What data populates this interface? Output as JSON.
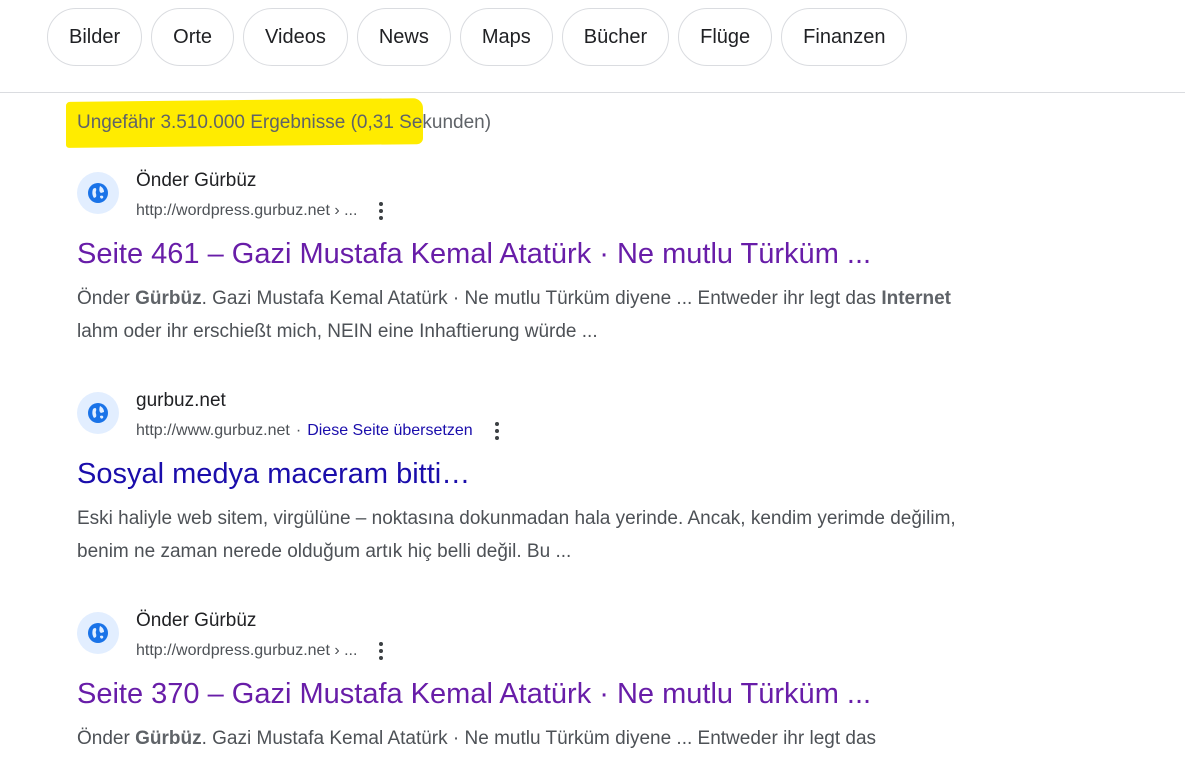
{
  "tabs": [
    {
      "label": "Bilder"
    },
    {
      "label": "Orte"
    },
    {
      "label": "Videos"
    },
    {
      "label": "News"
    },
    {
      "label": "Maps"
    },
    {
      "label": "Bücher"
    },
    {
      "label": "Flüge"
    },
    {
      "label": "Finanzen"
    }
  ],
  "stats": {
    "text": "Ungefähr 3.510.000 Ergebnisse (0,31 Sekunden)"
  },
  "results": [
    {
      "site_name": "Önder Gürbüz",
      "url": "http://wordpress.gurbuz.net › ...",
      "title": "Seite 461 – Gazi Mustafa Kemal Atatürk · Ne mutlu Türküm ...",
      "snippet_parts": [
        {
          "t": "Önder ",
          "b": false
        },
        {
          "t": "Gürbüz",
          "b": true
        },
        {
          "t": ". Gazi Mustafa Kemal Atatürk · Ne mutlu Türküm diyene ... Entweder ihr legt das ",
          "b": false
        },
        {
          "t": "Internet",
          "b": true
        },
        {
          "t": " lahm oder ihr erschießt mich, NEIN eine Inhaftierung würde ...",
          "b": false
        }
      ]
    },
    {
      "site_name": "gurbuz.net",
      "url": "http://www.gurbuz.net",
      "separator": "·",
      "translate_label": "Diese Seite übersetzen",
      "title": "Sosyal medya maceram bitti…",
      "snippet_parts": [
        {
          "t": "Eski haliyle web sitem, virgülüne – noktasına dokunmadan hala yerinde. Ancak, kendim yerimde değilim, benim ne zaman nerede olduğum artık hiç belli değil. Bu ...",
          "b": false
        }
      ]
    },
    {
      "site_name": "Önder Gürbüz",
      "url": "http://wordpress.gurbuz.net › ...",
      "title": "Seite 370 – Gazi Mustafa Kemal Atatürk · Ne mutlu Türküm ...",
      "snippet_parts": [
        {
          "t": "Önder ",
          "b": false
        },
        {
          "t": "Gürbüz",
          "b": true
        },
        {
          "t": ". Gazi Mustafa Kemal Atatürk · Ne mutlu Türküm diyene ... Entweder ihr legt das",
          "b": false
        }
      ]
    }
  ],
  "icons": {
    "favicon": "globe-icon",
    "more": "more-vert-icon"
  },
  "colors": {
    "highlight": "#ffec00",
    "visited_link": "#681da8",
    "link": "#1a0dab",
    "favicon_bg": "#e2eeff",
    "favicon_fg": "#1a73e8"
  }
}
